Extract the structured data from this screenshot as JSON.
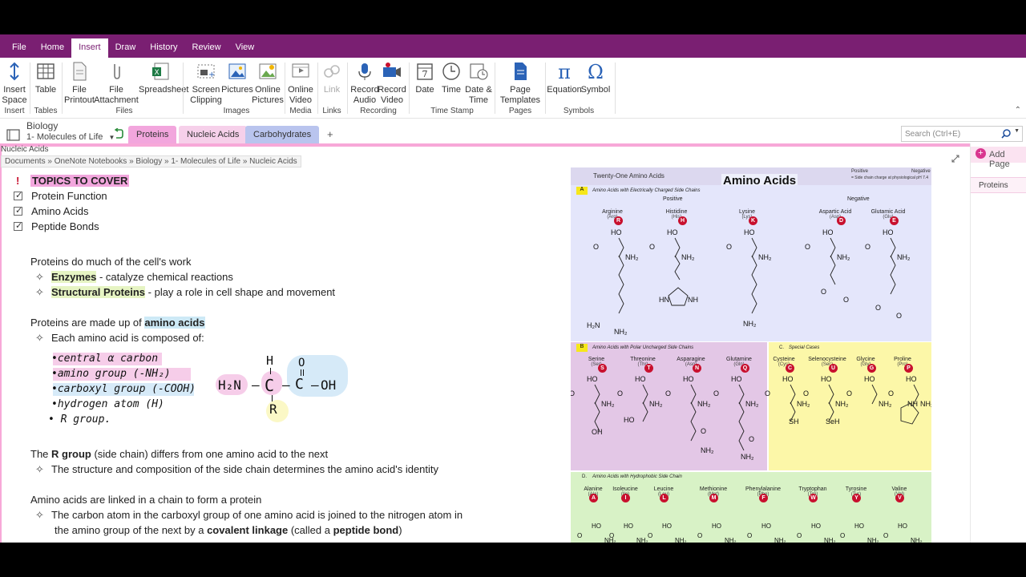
{
  "menu_tabs": [
    "File",
    "Home",
    "Insert",
    "Draw",
    "History",
    "Review",
    "View"
  ],
  "active_tab": "Insert",
  "ribbon": {
    "buttons": [
      {
        "label": "Insert\nSpace",
        "icon": "insert-space-icon"
      },
      {
        "label": "Table",
        "icon": "table-icon"
      },
      {
        "label": "File\nPrintout",
        "icon": "file-printout-icon"
      },
      {
        "label": "File\nAttachment",
        "icon": "file-attachment-icon"
      },
      {
        "label": "Spreadsheet",
        "icon": "spreadsheet-icon"
      },
      {
        "label": "Screen\nClipping",
        "icon": "screen-clipping-icon"
      },
      {
        "label": "Pictures",
        "icon": "pictures-icon"
      },
      {
        "label": "Online\nPictures",
        "icon": "online-pictures-icon"
      },
      {
        "label": "Online\nVideo",
        "icon": "online-video-icon"
      },
      {
        "label": "Link",
        "icon": "link-icon"
      },
      {
        "label": "Record\nAudio",
        "icon": "record-audio-icon"
      },
      {
        "label": "Record\nVideo",
        "icon": "record-video-icon"
      },
      {
        "label": "Date",
        "icon": "date-icon"
      },
      {
        "label": "Time",
        "icon": "time-icon"
      },
      {
        "label": "Date &\nTime",
        "icon": "date-time-icon"
      },
      {
        "label": "Page\nTemplates",
        "icon": "page-templates-icon"
      },
      {
        "label": "Equation",
        "icon": "equation-icon"
      },
      {
        "label": "Symbol",
        "icon": "symbol-icon"
      }
    ],
    "groups": [
      "Insert",
      "Tables",
      "Files",
      "Images",
      "Media",
      "Links",
      "Recording",
      "Time Stamp",
      "Pages",
      "Symbols"
    ],
    "equation_glyph": "π",
    "symbol_glyph": "Ω",
    "date_glyph": "7"
  },
  "notebook": {
    "name": "Biology",
    "section_group": "1- Molecules of Life",
    "section_tabs": [
      "Proteins",
      "Nucleic Acids",
      "Carbohydrates"
    ],
    "add_tab": "+",
    "search_placeholder": "Search (Ctrl+E)"
  },
  "page": {
    "title_small": "Nucleic Acids",
    "breadcrumb": "Documents » OneNote Notebooks » Biology » 1- Molecules of Life » Nucleic Acids",
    "add_page": "Add Page",
    "pages": [
      "Proteins"
    ]
  },
  "note": {
    "topics_mark": "!",
    "topics_heading": "TOPICS TO COVER",
    "topics": [
      "Protein Function",
      "Amino Acids",
      "Peptide Bonds"
    ],
    "p1": "Proteins do much of the cell's work",
    "p1_b1_bold": "Enzymes",
    "p1_b1_rest": " - catalyze chemical reactions",
    "p1_b2_bold": "Structural Proteins",
    "p1_b2_rest": " - play a role in cell shape and movement",
    "p2_start": "Proteins are made up of ",
    "p2_bold": "amino acids",
    "p2_b1": "Each amino acid is composed of:",
    "handwritten": [
      "•central α carbon",
      "•amino group (-NH₂)",
      "•carboxyl group (-COOH)",
      "•hydrogen atom (H)",
      "• R group."
    ],
    "structure": {
      "h": "H",
      "amine": "H₂N",
      "carbon": "C",
      "o": "O",
      "oh": "OH",
      "r": "R",
      "dash": "–"
    },
    "p3_start": "The ",
    "p3_bold": "R group",
    "p3_rest": " (side chain) differs from one amino acid to the next",
    "p3_b1": "The structure and composition of the side chain determines the amino acid's identity",
    "p4": "Amino acids are linked in a chain to form a protein",
    "p4_b1_line1": "The carbon atom in the carboxyl group of one amino acid is joined to the nitrogen atom in",
    "p4_b1_line2_start": "the amino group of the next by a ",
    "p4_b1_bold1": "covalent linkage",
    "p4_b1_mid": " (called a ",
    "p4_b1_bold2": "peptide bond",
    "p4_b1_end": ")"
  },
  "chart": {
    "header": "Twenty-One Amino Acids",
    "overlay_title": "Amino Acids",
    "legend_positive": "Positive",
    "legend_negative": "Negative",
    "legend_note": "= Side chain charge at physiological pH 7.4",
    "panel_a_title": "Amino Acids with Electrically Charged Side Chains",
    "panel_a_letter": "A",
    "positive": "Positive",
    "negative": "Negative",
    "charged": [
      {
        "name": "Arginine",
        "abbr": "(Arg)",
        "code": "R"
      },
      {
        "name": "Histidine",
        "abbr": "(His)",
        "code": "H"
      },
      {
        "name": "Lysine",
        "abbr": "(Lys)",
        "code": "K"
      },
      {
        "name": "Aspartic Acid",
        "abbr": "(Asp)",
        "code": "D"
      },
      {
        "name": "Glutamic Acid",
        "abbr": "(Glu)",
        "code": "E"
      }
    ],
    "panel_b_letter": "B",
    "panel_b_title": "Amino Acids with Polar Uncharged Side Chains",
    "polar": [
      {
        "name": "Serine",
        "abbr": "(Ser)",
        "code": "S"
      },
      {
        "name": "Threonine",
        "abbr": "(Thr)",
        "code": "T"
      },
      {
        "name": "Asparagine",
        "abbr": "(Asn)",
        "code": "N"
      },
      {
        "name": "Glutamine",
        "abbr": "(Gln)",
        "code": "Q"
      }
    ],
    "panel_c_letter": "C.",
    "panel_c_title": "Special Cases",
    "special": [
      {
        "name": "Cysteine",
        "abbr": "(Cys)",
        "code": "C"
      },
      {
        "name": "Selenocysteine",
        "abbr": "(Sec)",
        "code": "U"
      },
      {
        "name": "Glycine",
        "abbr": "(Gly)",
        "code": "G"
      },
      {
        "name": "Proline",
        "abbr": "(Pro)",
        "code": "P"
      }
    ],
    "panel_d_letter": "D.",
    "panel_d_title": "Amino Acids with Hydrophobic Side Chain",
    "hydrophobic": [
      {
        "name": "Alanine",
        "abbr": "(Ala)",
        "code": "A"
      },
      {
        "name": "Isoleucine",
        "abbr": "(Ile)",
        "code": "I"
      },
      {
        "name": "Leucine",
        "abbr": "(Leu)",
        "code": "L"
      },
      {
        "name": "Methionine",
        "abbr": "(Met)",
        "code": "M"
      },
      {
        "name": "Phenylalanine",
        "abbr": "(Phe)",
        "code": "F"
      },
      {
        "name": "Tryptophan",
        "abbr": "(Trp)",
        "code": "W"
      },
      {
        "name": "Tyrosine",
        "abbr": "(Tyr)",
        "code": "Y"
      },
      {
        "name": "Valine",
        "abbr": "(Val)",
        "code": "V"
      }
    ],
    "atom_labels": {
      "o": "O",
      "ho": "HO",
      "nh2": "NH₂",
      "nh": "NH",
      "hn": "HN",
      "sh": "SH",
      "seh": "SeH",
      "oh": "OH",
      "h2n": "H₂N"
    }
  },
  "colors": {
    "titlebar": "#7a1f72",
    "section_proteins": "#f2a6dd",
    "section_nucleic": "#f6d0ea",
    "section_carbs": "#b9c4ee",
    "panel_a": "#e4e6fb",
    "panel_b": "#e3c7e6",
    "panel_c": "#fcf7a8",
    "panel_d": "#d8f2c6",
    "badge": "#c8102e"
  }
}
